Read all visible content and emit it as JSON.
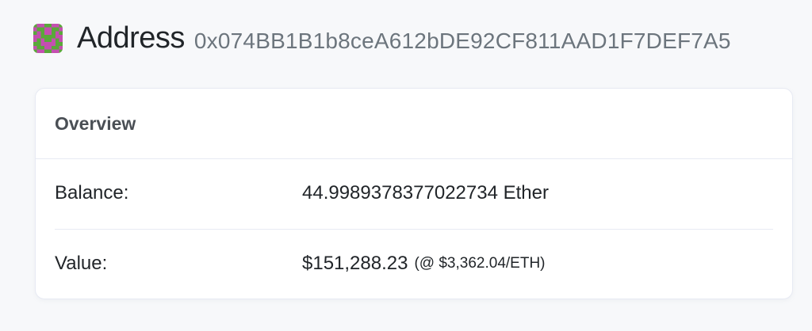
{
  "header": {
    "title": "Address",
    "address": "0x074BB1B1b8ceA612bDE92CF811AAD1F7DEF7A5",
    "identicon": "identicon",
    "colors": {
      "identicon_green": "#5aa83a",
      "identicon_magenta": "#c44fb0"
    }
  },
  "overview": {
    "title": "Overview",
    "balance_label": "Balance:",
    "balance_value": "44.9989378377022734 Ether",
    "value_label": "Value:",
    "value_amount": "$151,288.23",
    "eth_price": "(@ $3,362.04/ETH)"
  }
}
